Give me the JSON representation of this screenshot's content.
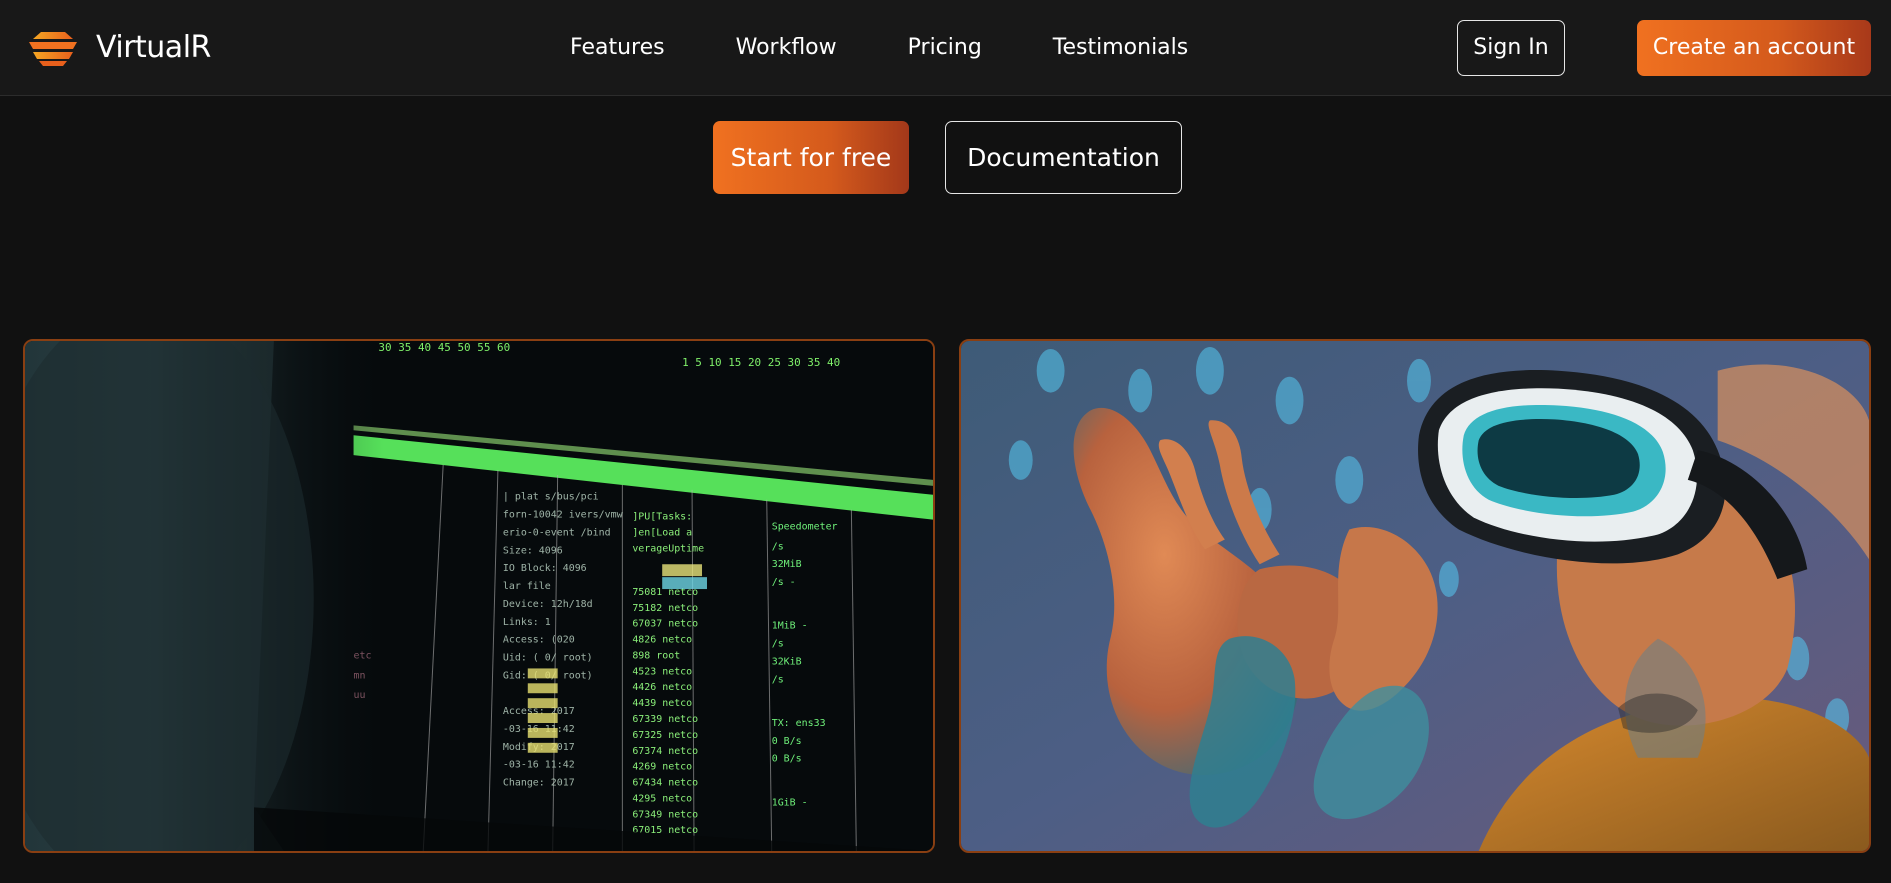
{
  "header": {
    "brand": "VirtualR",
    "logo_icon": "stacked-layers-logo-icon",
    "nav_links": [
      "Features",
      "Workflow",
      "Pricing",
      "Testimonials"
    ],
    "sign_in_label": "Sign In",
    "create_account_label": "Create an account"
  },
  "hero": {
    "start_label": "Start for free",
    "docs_label": "Documentation"
  },
  "colors": {
    "accent_orange": "#f07120",
    "accent_dark_orange": "#a8391a",
    "background": "#111111",
    "card_border": "#8a3f12"
  },
  "images": {
    "left": "terminal-monitor-photo",
    "right": "vr-headset-person-photo"
  }
}
